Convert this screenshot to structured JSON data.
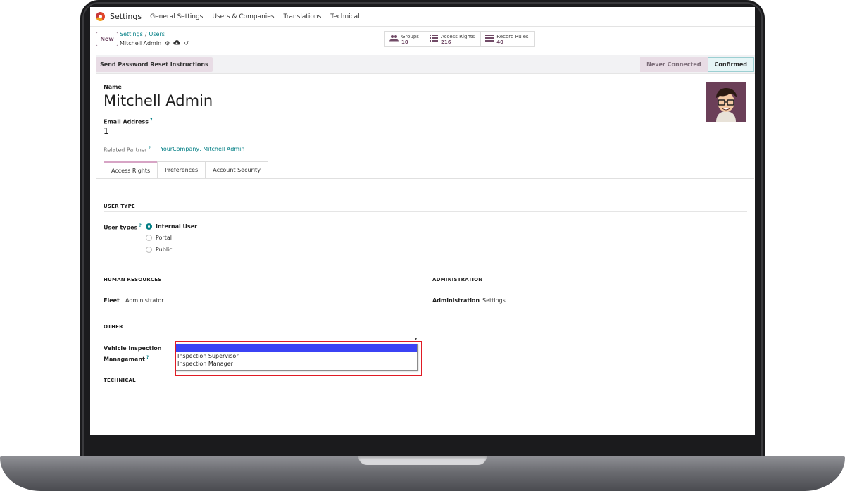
{
  "navbar": {
    "app_name": "Settings",
    "items": [
      "General Settings",
      "Users & Companies",
      "Translations",
      "Technical"
    ]
  },
  "control_panel": {
    "new_label": "New",
    "breadcrumb": [
      "Settings",
      "Users"
    ],
    "record_name": "Mitchell Admin",
    "stats": [
      {
        "label": "Groups",
        "value": "10",
        "icon": "users-icon"
      },
      {
        "label": "Access Rights",
        "value": "216",
        "icon": "list-icon"
      },
      {
        "label": "Record Rules",
        "value": "40",
        "icon": "list-icon"
      }
    ]
  },
  "statusbar": {
    "reset_button": "Send Password Reset Instructions",
    "stages": [
      "Never Connected",
      "Confirmed"
    ],
    "active_stage": "Confirmed"
  },
  "form": {
    "name_label": "Name",
    "name_value": "Mitchell Admin",
    "email_label": "Email Address",
    "email_value": "1",
    "partner_label": "Related Partner",
    "partner_value": "YourCompany, Mitchell Admin",
    "help_mark": "?",
    "tabs": [
      "Access Rights",
      "Preferences",
      "Account Security"
    ],
    "user_type_header": "USER TYPE",
    "user_types_label": "User types",
    "user_type_options": [
      "Internal User",
      "Portal",
      "Public"
    ],
    "selected_user_type": "Internal User",
    "hr_header": "HUMAN RESOURCES",
    "fleet_label": "Fleet",
    "fleet_value": "Administrator",
    "admin_header": "ADMINISTRATION",
    "admin_label": "Administration",
    "admin_value": "Settings",
    "other_header": "OTHER",
    "vim_label_line1": "Vehicle Inspection",
    "vim_label_line2": "Management",
    "technical_header": "TECHNICAL"
  },
  "dropdown": {
    "options": [
      "",
      "Inspection Supervisor",
      "Inspection Manager"
    ],
    "highlight_color": "#e01b24",
    "selected_color": "#3b43f5"
  },
  "colors": {
    "brand": "#714b67",
    "accent": "#017e84"
  }
}
